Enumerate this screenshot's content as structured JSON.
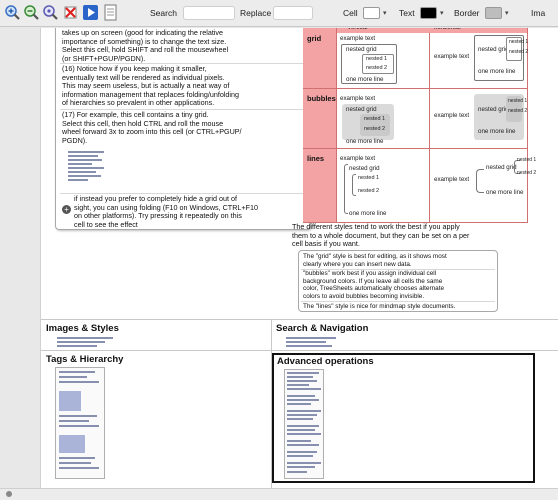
{
  "toolbar": {
    "search_label": "Search",
    "replace_label": "Replace",
    "cell_label": "Cell",
    "text_label": "Text",
    "border_label": "Border",
    "image_label": "Ima",
    "cell_color": "#ffffff",
    "text_color": "#000000",
    "border_color": "#bdbdbd"
  },
  "left_panel": {
    "lines_a": [
      "takes up on screen (good for indicating the relative",
      "importance of something) is to change the text size.",
      "Select this cell, hold SHIFT and roll the mousewheel",
      "(or SHIFT+PGUP/PGDN)."
    ],
    "lines_b": [
      "(16) Notice how if you keep making it smaller,",
      "eventually text will be rendered as individual pixels.",
      "This may seem useless, but is actually a neat way of",
      "information management that replaces folding/unfolding",
      "of hierarchies so prevalent in other applications."
    ],
    "lines_c": [
      "(17) For example, this cell contains a tiny grid.",
      "Select this cell, then hold CTRL and roll the mouse",
      "wheel forward 3x to zoom into this cell (or CTRL+PGUP/",
      "PGDN)."
    ],
    "lines_d": [
      "if instead you prefer to completely hide a grid out of",
      "sight, you can using folding (F10 on Windows, CTRL+F10",
      "on other platforms). Try pressing it repeatedly on this",
      "cell to see the effect"
    ]
  },
  "styles": {
    "header_left": "vertical",
    "header_right": "horizontal",
    "grid_label": "grid",
    "bubbles_label": "bubbles",
    "lines_label": "lines",
    "example_text": "example text",
    "nested_grid": "nested grid",
    "nested_1": "nested 1",
    "nested_2": "nested 2",
    "one_more_line": "one more line"
  },
  "notes": {
    "intro_lines": [
      "The different styles tend to work the best if you apply",
      "them to a whole document, but they can be set on a per",
      "cell basis if you want."
    ],
    "note1": [
      "The \"grid\" style is best for editing, as it shows most",
      "clearly where you can insert new data."
    ],
    "note2": [
      "\"bubbles\" work best if you assign individual cell",
      "background colors. If you leave all cells the same",
      "color, TreeSheets automatically chooses alternate",
      "colors to avoid bubbles becoming invisible."
    ],
    "note3": [
      "The \"lines\" style is nice for mindmap style documents."
    ]
  },
  "sections": {
    "images_styles": "Images & Styles",
    "search_navigation": "Search & Navigation",
    "tags_hierarchy": "Tags & Hierarchy",
    "advanced_operations": "Advanced operations"
  }
}
